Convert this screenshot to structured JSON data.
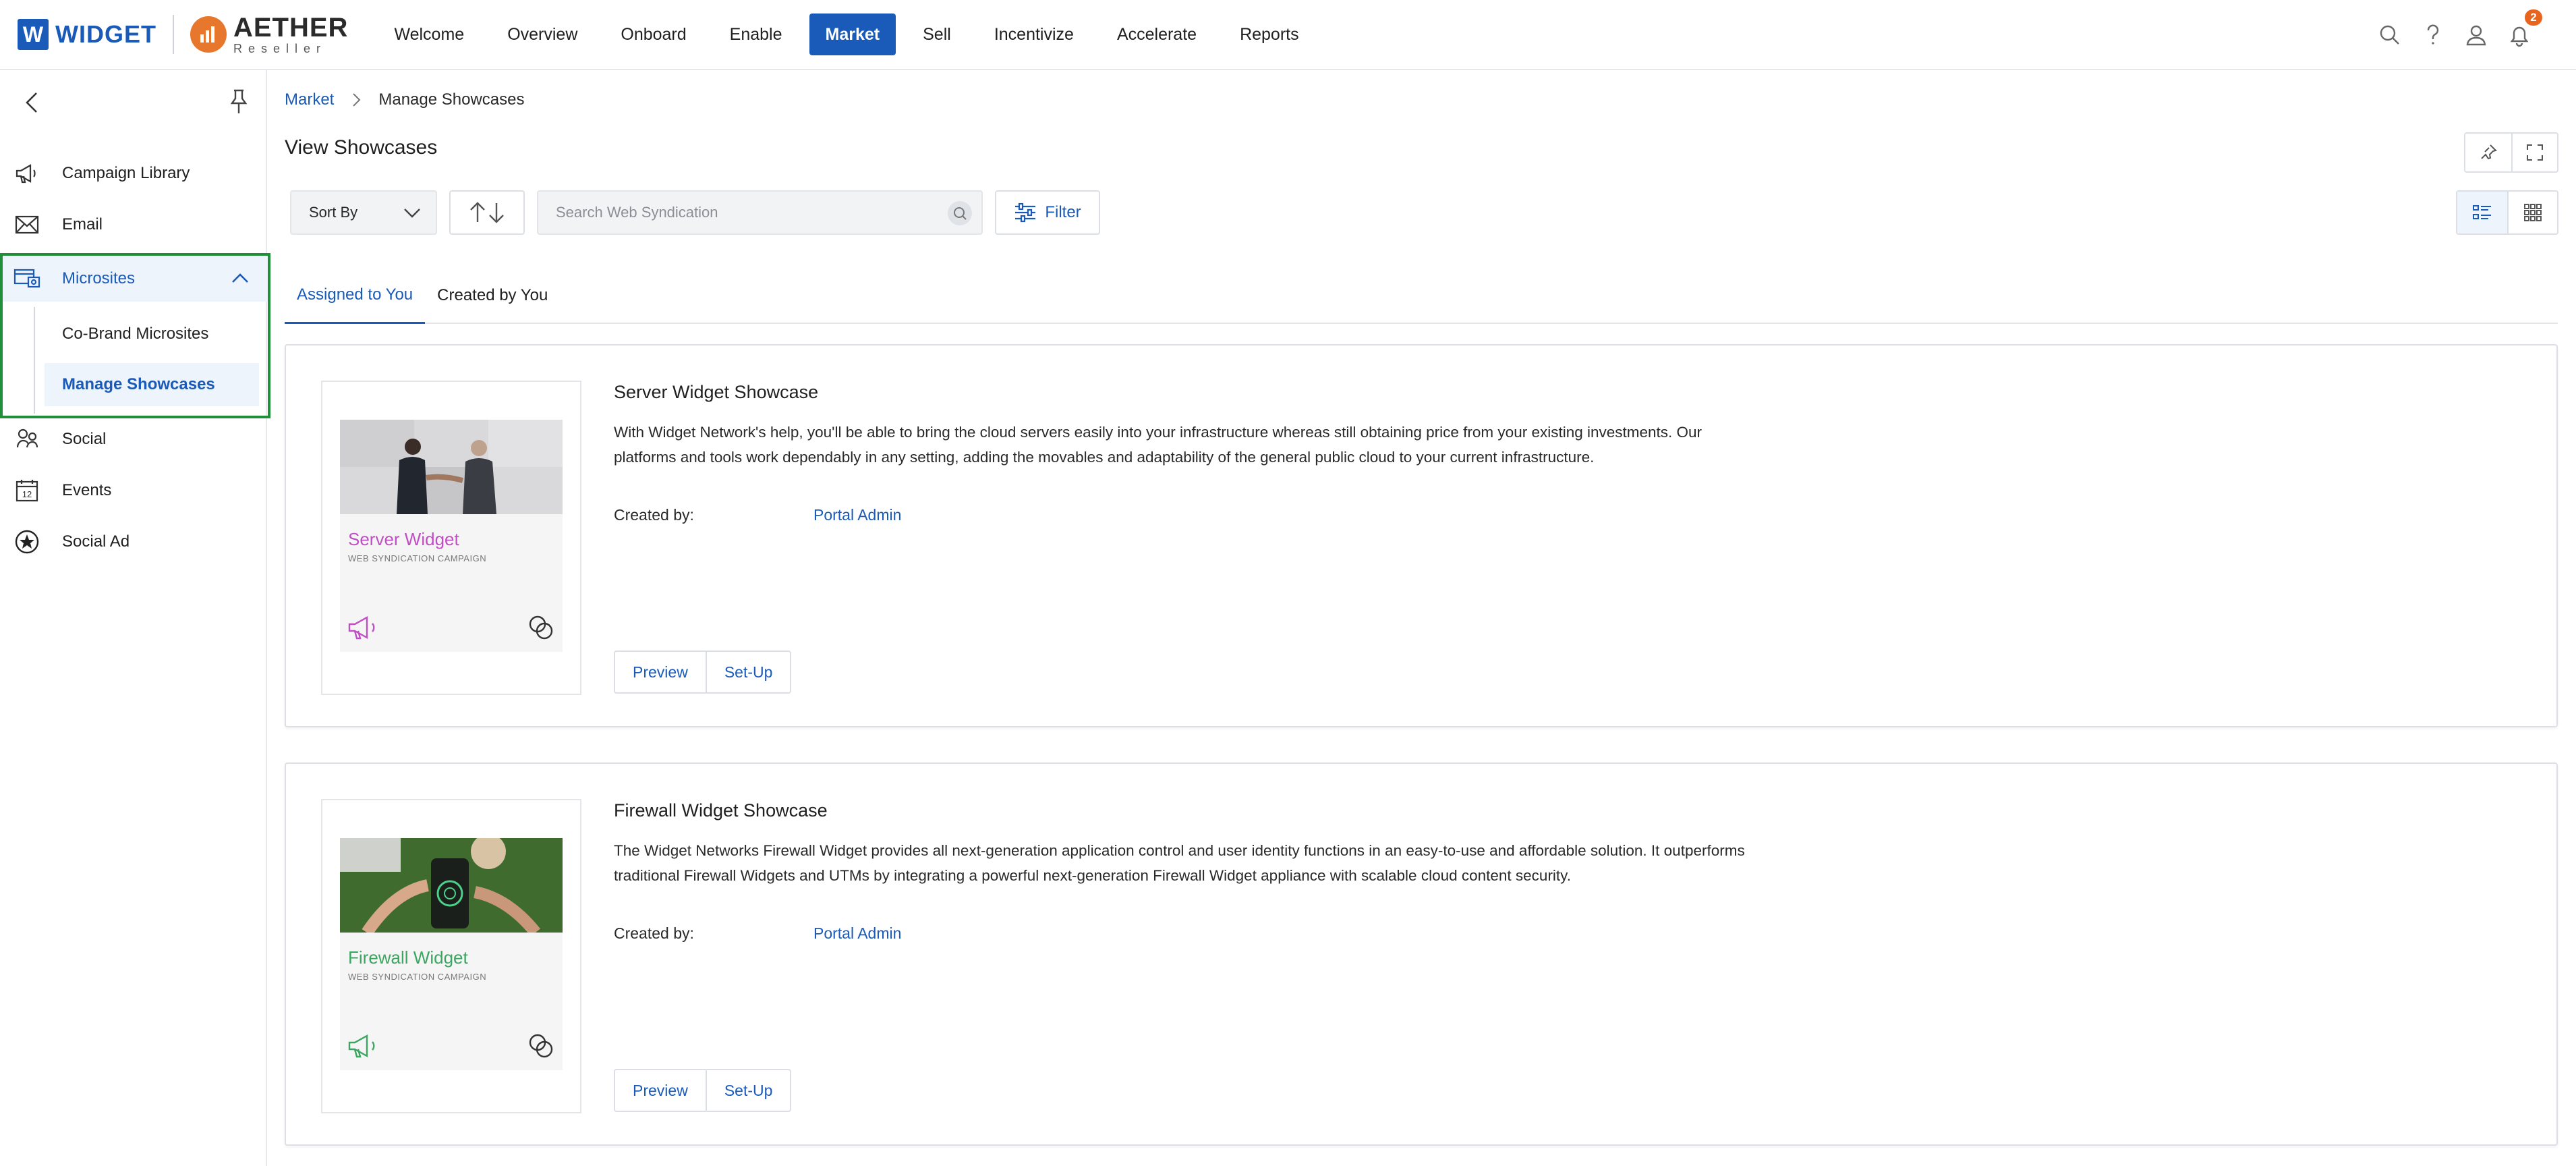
{
  "brand": {
    "widget_letter": "W",
    "widget_name": "WIDGET",
    "aether_name": "AETHER",
    "aether_sub": "Reseller"
  },
  "nav": {
    "items": [
      {
        "label": "Welcome"
      },
      {
        "label": "Overview"
      },
      {
        "label": "Onboard"
      },
      {
        "label": "Enable"
      },
      {
        "label": "Market",
        "active": true
      },
      {
        "label": "Sell"
      },
      {
        "label": "Incentivize"
      },
      {
        "label": "Accelerate"
      },
      {
        "label": "Reports"
      }
    ]
  },
  "header_icons": {
    "search": "search-icon",
    "help": "help-icon",
    "user": "user-icon",
    "notifications": "bell-icon",
    "notification_count": "2"
  },
  "sidebar": {
    "items": [
      {
        "label": "Campaign Library",
        "icon": "megaphone-icon"
      },
      {
        "label": "Email",
        "icon": "envelope-icon"
      },
      {
        "label": "Microsites",
        "icon": "microsite-icon",
        "expanded": true
      },
      {
        "label": "Social",
        "icon": "social-icon"
      },
      {
        "label": "Events",
        "icon": "calendar-icon"
      },
      {
        "label": "Social Ad",
        "icon": "star-badge-icon"
      }
    ],
    "microsites_children": [
      {
        "label": "Co-Brand Microsites"
      },
      {
        "label": "Manage Showcases",
        "active": true
      }
    ],
    "calendar_day": "12"
  },
  "breadcrumb": {
    "parent": "Market",
    "current": "Manage Showcases"
  },
  "page": {
    "title": "View Showcases"
  },
  "toolbar": {
    "sort_label": "Sort By",
    "search_placeholder": "Search Web Syndication",
    "filter_label": "Filter"
  },
  "tabs": [
    {
      "label": "Assigned to You",
      "active": true
    },
    {
      "label": "Created by You"
    }
  ],
  "showcases": [
    {
      "title": "Server Widget Showcase",
      "description": "With Widget Network's help, you'll be able to bring the cloud servers easily into your infrastructure whereas still obtaining price from your existing investments. Our platforms and tools work dependably in any setting, adding the movables and adaptability of the general public cloud to your current infrastructure.",
      "created_by_label": "Created by:",
      "created_by": "Portal Admin",
      "thumb_title": "Server Widget",
      "thumb_sub": "WEB SYNDICATION CAMPAIGN",
      "accent": "#c04fc4",
      "preview_label": "Preview",
      "setup_label": "Set-Up"
    },
    {
      "title": "Firewall Widget Showcase",
      "description": "The Widget Networks Firewall Widget provides all next-generation application control and user identity functions in an easy-to-use and affordable solution. It outperforms traditional Firewall Widgets and UTMs by integrating a powerful next-generation Firewall Widget appliance with scalable cloud content security.",
      "created_by_label": "Created by:",
      "created_by": "Portal Admin",
      "thumb_title": "Firewall Widget",
      "thumb_sub": "WEB SYNDICATION CAMPAIGN",
      "accent": "#3aa660",
      "preview_label": "Preview",
      "setup_label": "Set-Up"
    }
  ],
  "colors": {
    "primary": "#1a5ab8",
    "highlight_border": "#1f8f3a",
    "badge": "#e8641e",
    "aether_orange": "#e8772e"
  }
}
